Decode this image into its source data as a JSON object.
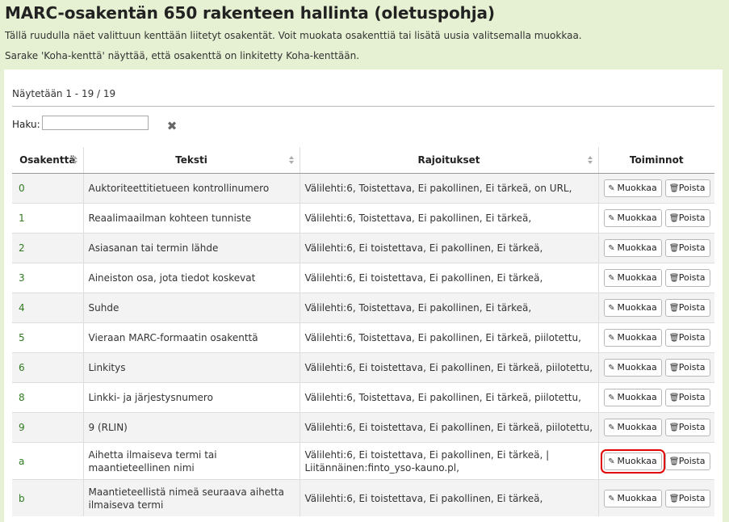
{
  "page": {
    "title": "MARC-osakentän 650 rakenteen hallinta (oletuspohja)",
    "intro1": "Tällä ruudulla näet valittuun kenttään liitetyt osakentät. Voit muokata osakenttiä tai lisätä uusia valitsemalla muokkaa.",
    "intro2": "Sarake 'Koha-kenttä' näyttää, että osakenttä on linkitetty Koha-kenttään."
  },
  "table": {
    "showing": "Näytetään 1 - 19 / 19",
    "search_label": "Haku:",
    "search_value": "",
    "headers": [
      "Osakenttä",
      "Teksti",
      "Rajoitukset",
      "Toiminnot"
    ],
    "edit_label": "Muokkaa",
    "delete_label": "Poista",
    "rows": [
      {
        "code": "0",
        "text": "Auktoriteettitietueen kontrollinumero",
        "limits": "Välilehti:6, Toistettava, Ei pakollinen, Ei tärkeä, on URL,"
      },
      {
        "code": "1",
        "text": "Reaalimaailman kohteen tunniste",
        "limits": "Välilehti:6, Toistettava, Ei pakollinen, Ei tärkeä,"
      },
      {
        "code": "2",
        "text": "Asiasanan tai termin lähde",
        "limits": "Välilehti:6, Ei toistettava, Ei pakollinen, Ei tärkeä,"
      },
      {
        "code": "3",
        "text": "Aineiston osa, jota tiedot koskevat",
        "limits": "Välilehti:6, Ei toistettava, Ei pakollinen, Ei tärkeä,"
      },
      {
        "code": "4",
        "text": "Suhde",
        "limits": "Välilehti:6, Toistettava, Ei pakollinen, Ei tärkeä,"
      },
      {
        "code": "5",
        "text": "Vieraan MARC-formaatin osakenttä",
        "limits": "Välilehti:6, Toistettava, Ei pakollinen, Ei tärkeä, piilotettu,"
      },
      {
        "code": "6",
        "text": "Linkitys",
        "limits": "Välilehti:6, Ei toistettava, Ei pakollinen, Ei tärkeä, piilotettu,"
      },
      {
        "code": "8",
        "text": "Linkki- ja järjestysnumero",
        "limits": "Välilehti:6, Toistettava, Ei pakollinen, Ei tärkeä, piilotettu,"
      },
      {
        "code": "9",
        "text": "9 (RLIN)",
        "limits": "Välilehti:6, Ei toistettava, Ei pakollinen, Ei tärkeä, piilotettu,"
      },
      {
        "code": "a",
        "text": "Aihetta ilmaiseva termi tai maantieteellinen nimi",
        "limits": "Välilehti:6, Ei toistettava, Ei pakollinen, Ei tärkeä, | Liitännäinen:finto_yso-kauno.pl,",
        "highlight": true
      },
      {
        "code": "b",
        "text": "Maantieteellistä nimeä seuraava aihetta ilmaiseva termi",
        "limits": "Välilehti:6, Ei toistettava, Ei pakollinen, Ei tärkeä,"
      }
    ]
  },
  "icons": {
    "edit": "pencil-icon",
    "delete": "trash-icon",
    "clear": "clear-filter-icon",
    "sort": "sort-icon"
  }
}
